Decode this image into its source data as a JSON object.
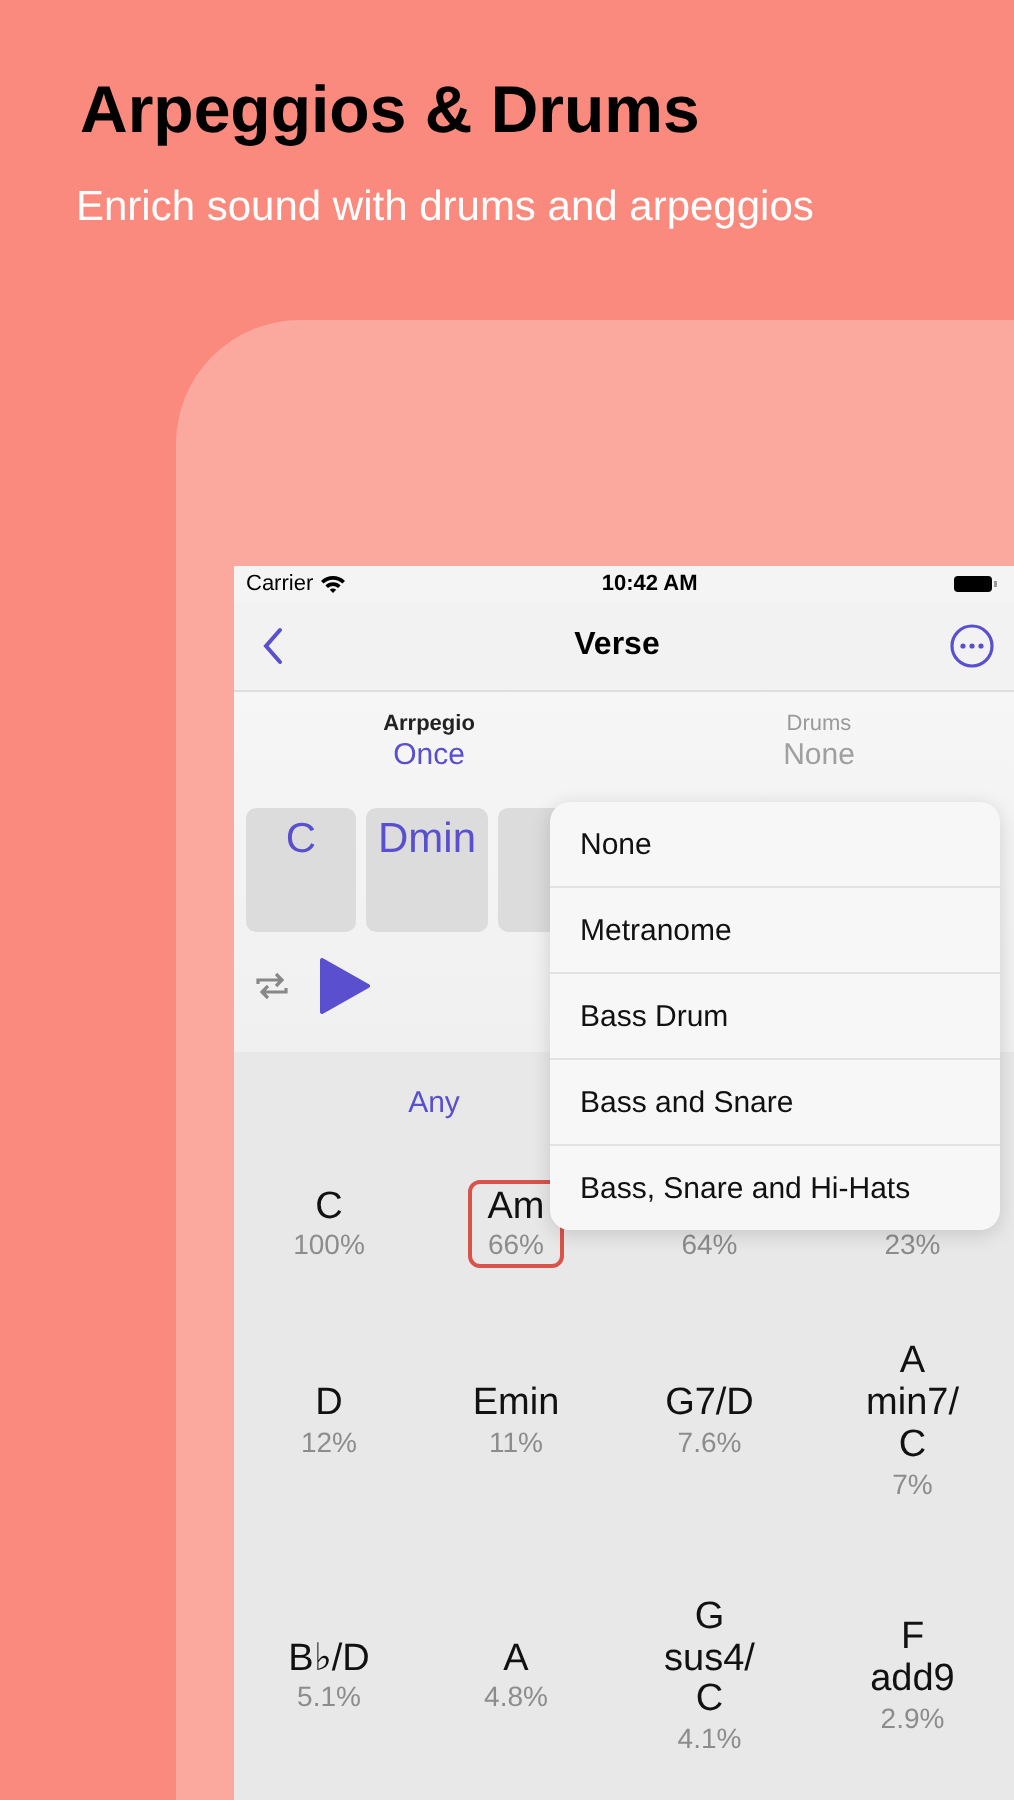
{
  "headline": "Arpeggios & Drums",
  "subtitle": "Enrich sound with drums and arpeggios",
  "status_bar": {
    "carrier": "Carrier",
    "time": "10:42 AM"
  },
  "nav": {
    "title": "Verse"
  },
  "modes": [
    {
      "label": "Arrpegio",
      "value": "Once",
      "disabled": false
    },
    {
      "label": "Drums",
      "value": "None",
      "disabled": true
    }
  ],
  "sequence": [
    {
      "chord": "C"
    },
    {
      "chord": "Dmin"
    }
  ],
  "section_header": "Any",
  "chords": [
    [
      {
        "name": "C",
        "percent": "100%",
        "selected": false
      },
      {
        "name": "Am",
        "percent": "66%",
        "selected": true
      },
      {
        "percent": "64%",
        "selected": false
      },
      {
        "percent": "23%",
        "selected": false
      }
    ],
    [
      {
        "name": "D",
        "percent": "12%",
        "selected": false
      },
      {
        "name": "Emin",
        "percent": "11%",
        "selected": false
      },
      {
        "name": "G7/D",
        "percent": "7.6%",
        "selected": false
      },
      {
        "name": "A\nmin7/\nC",
        "percent": "7%",
        "selected": false
      }
    ],
    [
      {
        "name": "B♭/D",
        "percent": "5.1%",
        "selected": false
      },
      {
        "name": "A",
        "percent": "4.8%",
        "selected": false
      },
      {
        "name": "G\nsus4/\nC",
        "percent": "4.1%",
        "selected": false
      },
      {
        "name": "F\nadd9",
        "percent": "2.9%",
        "selected": false
      }
    ]
  ],
  "menu": [
    "None",
    "Metranome",
    "Bass Drum",
    "Bass and Snare",
    "Bass, Snare and Hi-Hats"
  ]
}
